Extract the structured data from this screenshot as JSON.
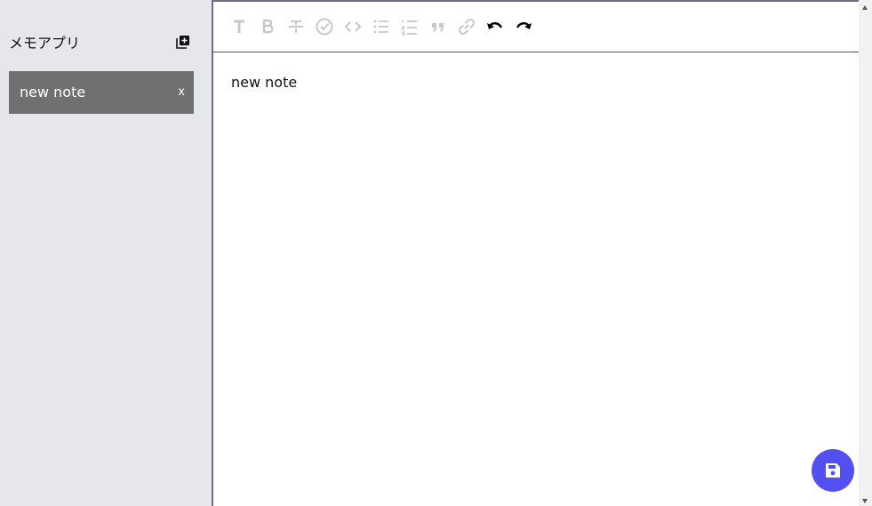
{
  "app": {
    "title": "メモアプリ",
    "accent_color": "#5250f0"
  },
  "sidebar": {
    "add_note_icon": "add-note-icon",
    "notes": [
      {
        "label": "new note",
        "delete_label": "x",
        "selected": true
      }
    ]
  },
  "toolbar": {
    "tools": [
      {
        "name": "heading-icon",
        "enabled": false
      },
      {
        "name": "bold-icon",
        "enabled": false
      },
      {
        "name": "strikethrough-icon",
        "enabled": false
      },
      {
        "name": "checklist-icon",
        "enabled": false
      },
      {
        "name": "code-icon",
        "enabled": false
      },
      {
        "name": "bullet-list-icon",
        "enabled": false
      },
      {
        "name": "ordered-list-icon",
        "enabled": false
      },
      {
        "name": "quote-icon",
        "enabled": false
      },
      {
        "name": "link-icon",
        "enabled": false
      },
      {
        "name": "undo-icon",
        "enabled": true
      },
      {
        "name": "redo-icon",
        "enabled": true
      }
    ]
  },
  "editor": {
    "content": "new note"
  },
  "fab": {
    "icon": "save-icon"
  }
}
